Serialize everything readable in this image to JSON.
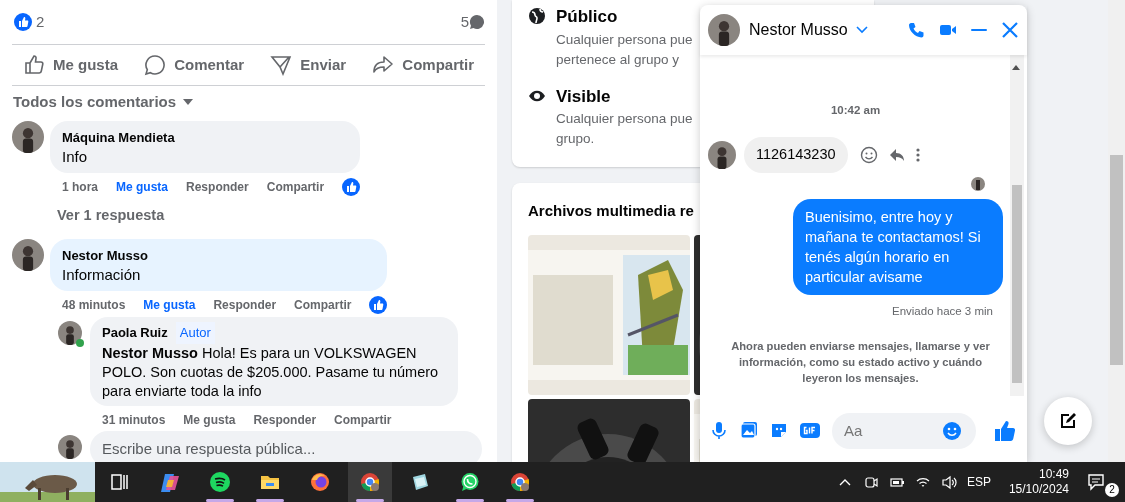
{
  "post": {
    "reactions_count": "2",
    "comments_count": "5",
    "actions": [
      {
        "kind": "like",
        "label": "Me gusta"
      },
      {
        "kind": "comment",
        "label": "Comentar"
      },
      {
        "kind": "send",
        "label": "Enviar"
      },
      {
        "kind": "share",
        "label": "Compartir"
      }
    ],
    "comments_filter": "Todos los comentarios"
  },
  "comments": [
    {
      "author": "Máquina Mendieta",
      "text": "Info",
      "highlighted": false,
      "time": "1 hora",
      "like": "Me gusta",
      "liked": true,
      "reply": "Responder",
      "share": "Compartir",
      "view_replies": "Ver 1 respuesta"
    },
    {
      "author": "Nestor Musso",
      "text": "Información",
      "highlighted": true,
      "time": "48 minutos",
      "like": "Me gusta",
      "liked": true,
      "reply": "Responder",
      "share": "Compartir",
      "replies": [
        {
          "author": "Paola Ruiz",
          "badge": "Autor",
          "online": true,
          "text": "**Nestor Musso** Hola! Es para un VOLKSWAGEN POLO. Son cuotas de $205.000. Pasame tu número para enviarte toda la info",
          "time": "31 minutos",
          "like": "Me gusta",
          "liked": false,
          "reply": "Responder",
          "share": "Compartir"
        }
      ]
    }
  ],
  "reply_box": {
    "placeholder": "Escribe una respuesta pública..."
  },
  "group_info": [
    {
      "kind": "globe",
      "title": "Público",
      "lines": [
        "Cualquier persona pue",
        "pertenece al grupo y"
      ]
    },
    {
      "kind": "eye",
      "title": "Visible",
      "lines": [
        "Cualquier persona pue",
        "grupo."
      ]
    }
  ],
  "media": {
    "title": "Archivos multimedia re"
  },
  "chat": {
    "contact": "Nestor Musso",
    "messages": [
      {
        "kind": "time",
        "text": "10:42 am"
      },
      {
        "kind": "incoming",
        "text": "1126143230"
      },
      {
        "kind": "outgoing",
        "text": "Buenisimo, entre hoy y mañana te contactamos! Si tenés algún horario en particular avisame",
        "status": "Enviado hace 3 min",
        "seen": true
      },
      {
        "kind": "notice",
        "text": "Ahora pueden enviarse mensajes, llamarse y ver información, como su estado activo y cuándo leyeron los mensajes."
      }
    ],
    "composer": {
      "placeholder": "Aa"
    }
  },
  "taskbar": {
    "apps": [
      {
        "kind": "taskview",
        "running": false,
        "selected": false
      },
      {
        "kind": "copilot",
        "running": false,
        "selected": false
      },
      {
        "kind": "spotify",
        "running": true,
        "selected": false
      },
      {
        "kind": "files",
        "running": true,
        "selected": false
      },
      {
        "kind": "firefox",
        "running": false,
        "selected": false
      },
      {
        "kind": "chrome",
        "running": true,
        "selected": true
      },
      {
        "kind": "notes",
        "running": false,
        "selected": false
      },
      {
        "kind": "whatsapp",
        "running": true,
        "selected": false
      },
      {
        "kind": "chrome",
        "running": true,
        "selected": false
      }
    ],
    "language": "ESP",
    "time": "10:49",
    "date": "15/10/2024",
    "notifications": "2"
  }
}
